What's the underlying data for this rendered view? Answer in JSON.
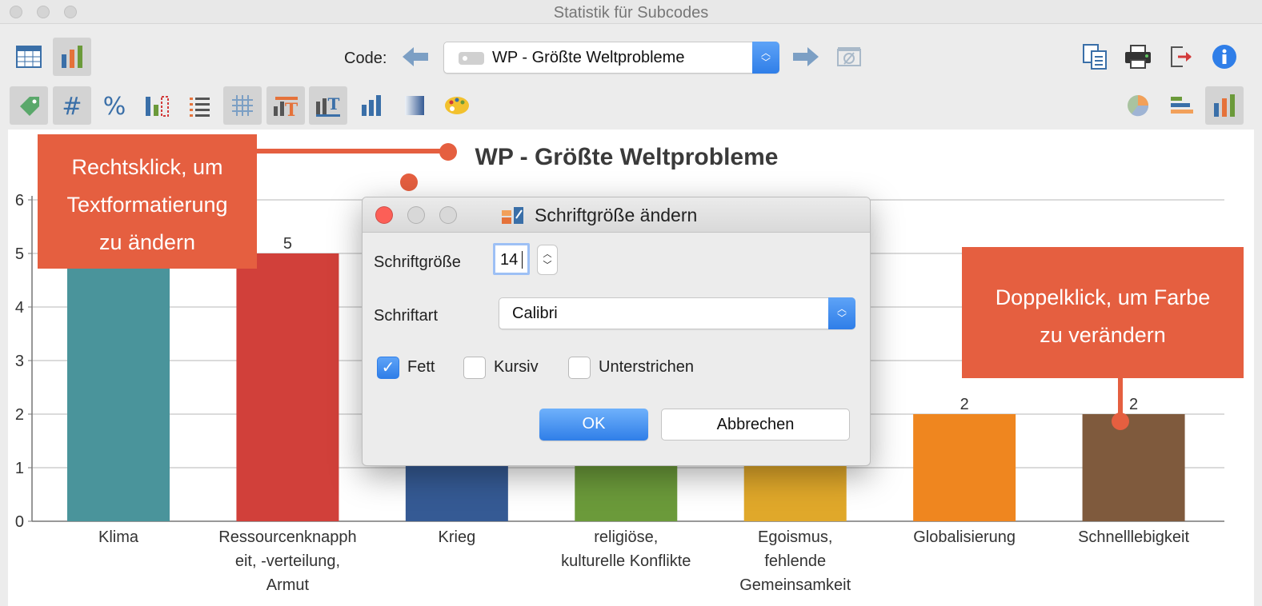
{
  "window": {
    "title": "Statistik für Subcodes"
  },
  "toolbar": {
    "code_label": "Code:",
    "code_value": "WP - Größte Weltprobleme"
  },
  "dialog": {
    "title": "Schriftgröße ändern",
    "font_size_label": "Schriftgröße",
    "font_size_value": "14",
    "font_family_label": "Schriftart",
    "font_family_value": "Calibri",
    "bold_label": "Fett",
    "bold_checked": true,
    "italic_label": "Kursiv",
    "italic_checked": false,
    "underline_label": "Unterstrichen",
    "underline_checked": false,
    "ok_label": "OK",
    "cancel_label": "Abbrechen"
  },
  "callouts": {
    "left": [
      "Rechtsklick, um",
      "Textformatierung",
      "zu ändern"
    ],
    "right": [
      "Doppelklick, um Farbe",
      "zu verändern"
    ]
  },
  "chart_data": {
    "type": "bar",
    "title": "WP - Größte Weltprobleme",
    "categories": [
      [
        "Klima"
      ],
      [
        "Ressourcenknapph",
        "eit, -verteilung,",
        "Armut"
      ],
      [
        "Krieg"
      ],
      [
        "religiöse,",
        "kulturelle Konflikte"
      ],
      [
        "Egoismus,",
        "fehlende",
        "Gemeinsamkeit"
      ],
      [
        "Globalisierung"
      ],
      [
        "Schnelllebigkeit"
      ]
    ],
    "values": [
      6,
      5,
      4,
      4,
      4,
      2,
      2
    ],
    "data_labels": [
      "",
      "5",
      "",
      "",
      "",
      "2",
      "2"
    ],
    "colors": [
      "#4a949b",
      "#d1403a",
      "#355a94",
      "#6b9a3a",
      "#e0a82a",
      "#ef861f",
      "#7f5a3d"
    ],
    "ylim": [
      0,
      6
    ],
    "yticks": [
      "0",
      "1",
      "2",
      "3",
      "4",
      "5",
      "6"
    ],
    "grid": true
  }
}
